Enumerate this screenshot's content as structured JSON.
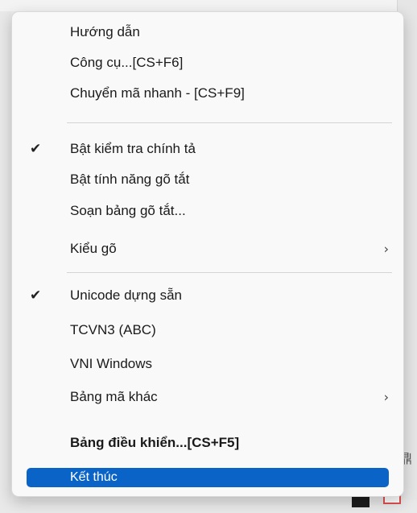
{
  "menu": {
    "items": [
      {
        "label": "Hướng dẫn"
      },
      {
        "label": "Công cụ...[CS+F6]"
      },
      {
        "label": "Chuyển mã nhanh - [CS+F9]"
      },
      {
        "label": "Bật kiểm tra chính tả",
        "checked": true
      },
      {
        "label": "Bật tính năng gõ tắt"
      },
      {
        "label": "Soạn bảng gõ tắt..."
      },
      {
        "label": "Kiểu gõ",
        "submenu": true
      },
      {
        "label": "Unicode dựng sẵn",
        "checked": true
      },
      {
        "label": "TCVN3 (ABC)"
      },
      {
        "label": "VNI Windows"
      },
      {
        "label": "Bảng mã khác",
        "submenu": true
      },
      {
        "label": "Bảng điều khiển...[CS+F5]",
        "bold": true
      },
      {
        "label": "Kết thúc",
        "highlighted": true
      }
    ],
    "check_glyph": "✔",
    "submenu_glyph": "›"
  },
  "colors": {
    "highlight": "#0a64c8",
    "menu_background": "#f9f9f9"
  },
  "tray": {
    "glyph": "鼎",
    "check_icon_glyph": "✓"
  }
}
